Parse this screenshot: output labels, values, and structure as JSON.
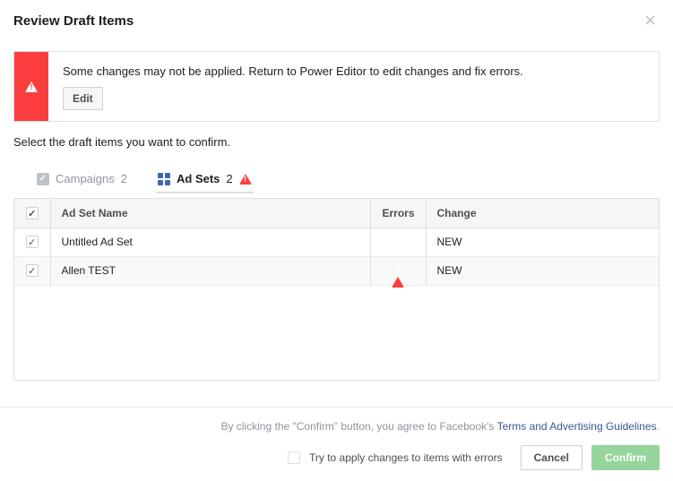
{
  "header": {
    "title": "Review Draft Items"
  },
  "alert": {
    "message": "Some changes may not be applied. Return to Power Editor to edit changes and fix errors.",
    "edit_label": "Edit"
  },
  "instruction": "Select the draft items you want to confirm.",
  "tabs": {
    "campaigns": {
      "label": "Campaigns",
      "count": "2"
    },
    "adsets": {
      "label": "Ad Sets",
      "count": "2",
      "has_error": true
    }
  },
  "table": {
    "headers": {
      "name": "Ad Set Name",
      "errors": "Errors",
      "change": "Change"
    },
    "rows": [
      {
        "name": "Untitled Ad Set",
        "error": false,
        "change": "NEW"
      },
      {
        "name": "Allen TEST",
        "error": true,
        "change": "NEW"
      }
    ]
  },
  "footer": {
    "legal_prefix": "By clicking the \"Confirm\" button, you agree to Facebook's ",
    "legal_link": "Terms and Advertising Guidelines",
    "legal_suffix": ".",
    "try_label": "Try to apply changes to items with errors",
    "cancel": "Cancel",
    "confirm": "Confirm"
  }
}
